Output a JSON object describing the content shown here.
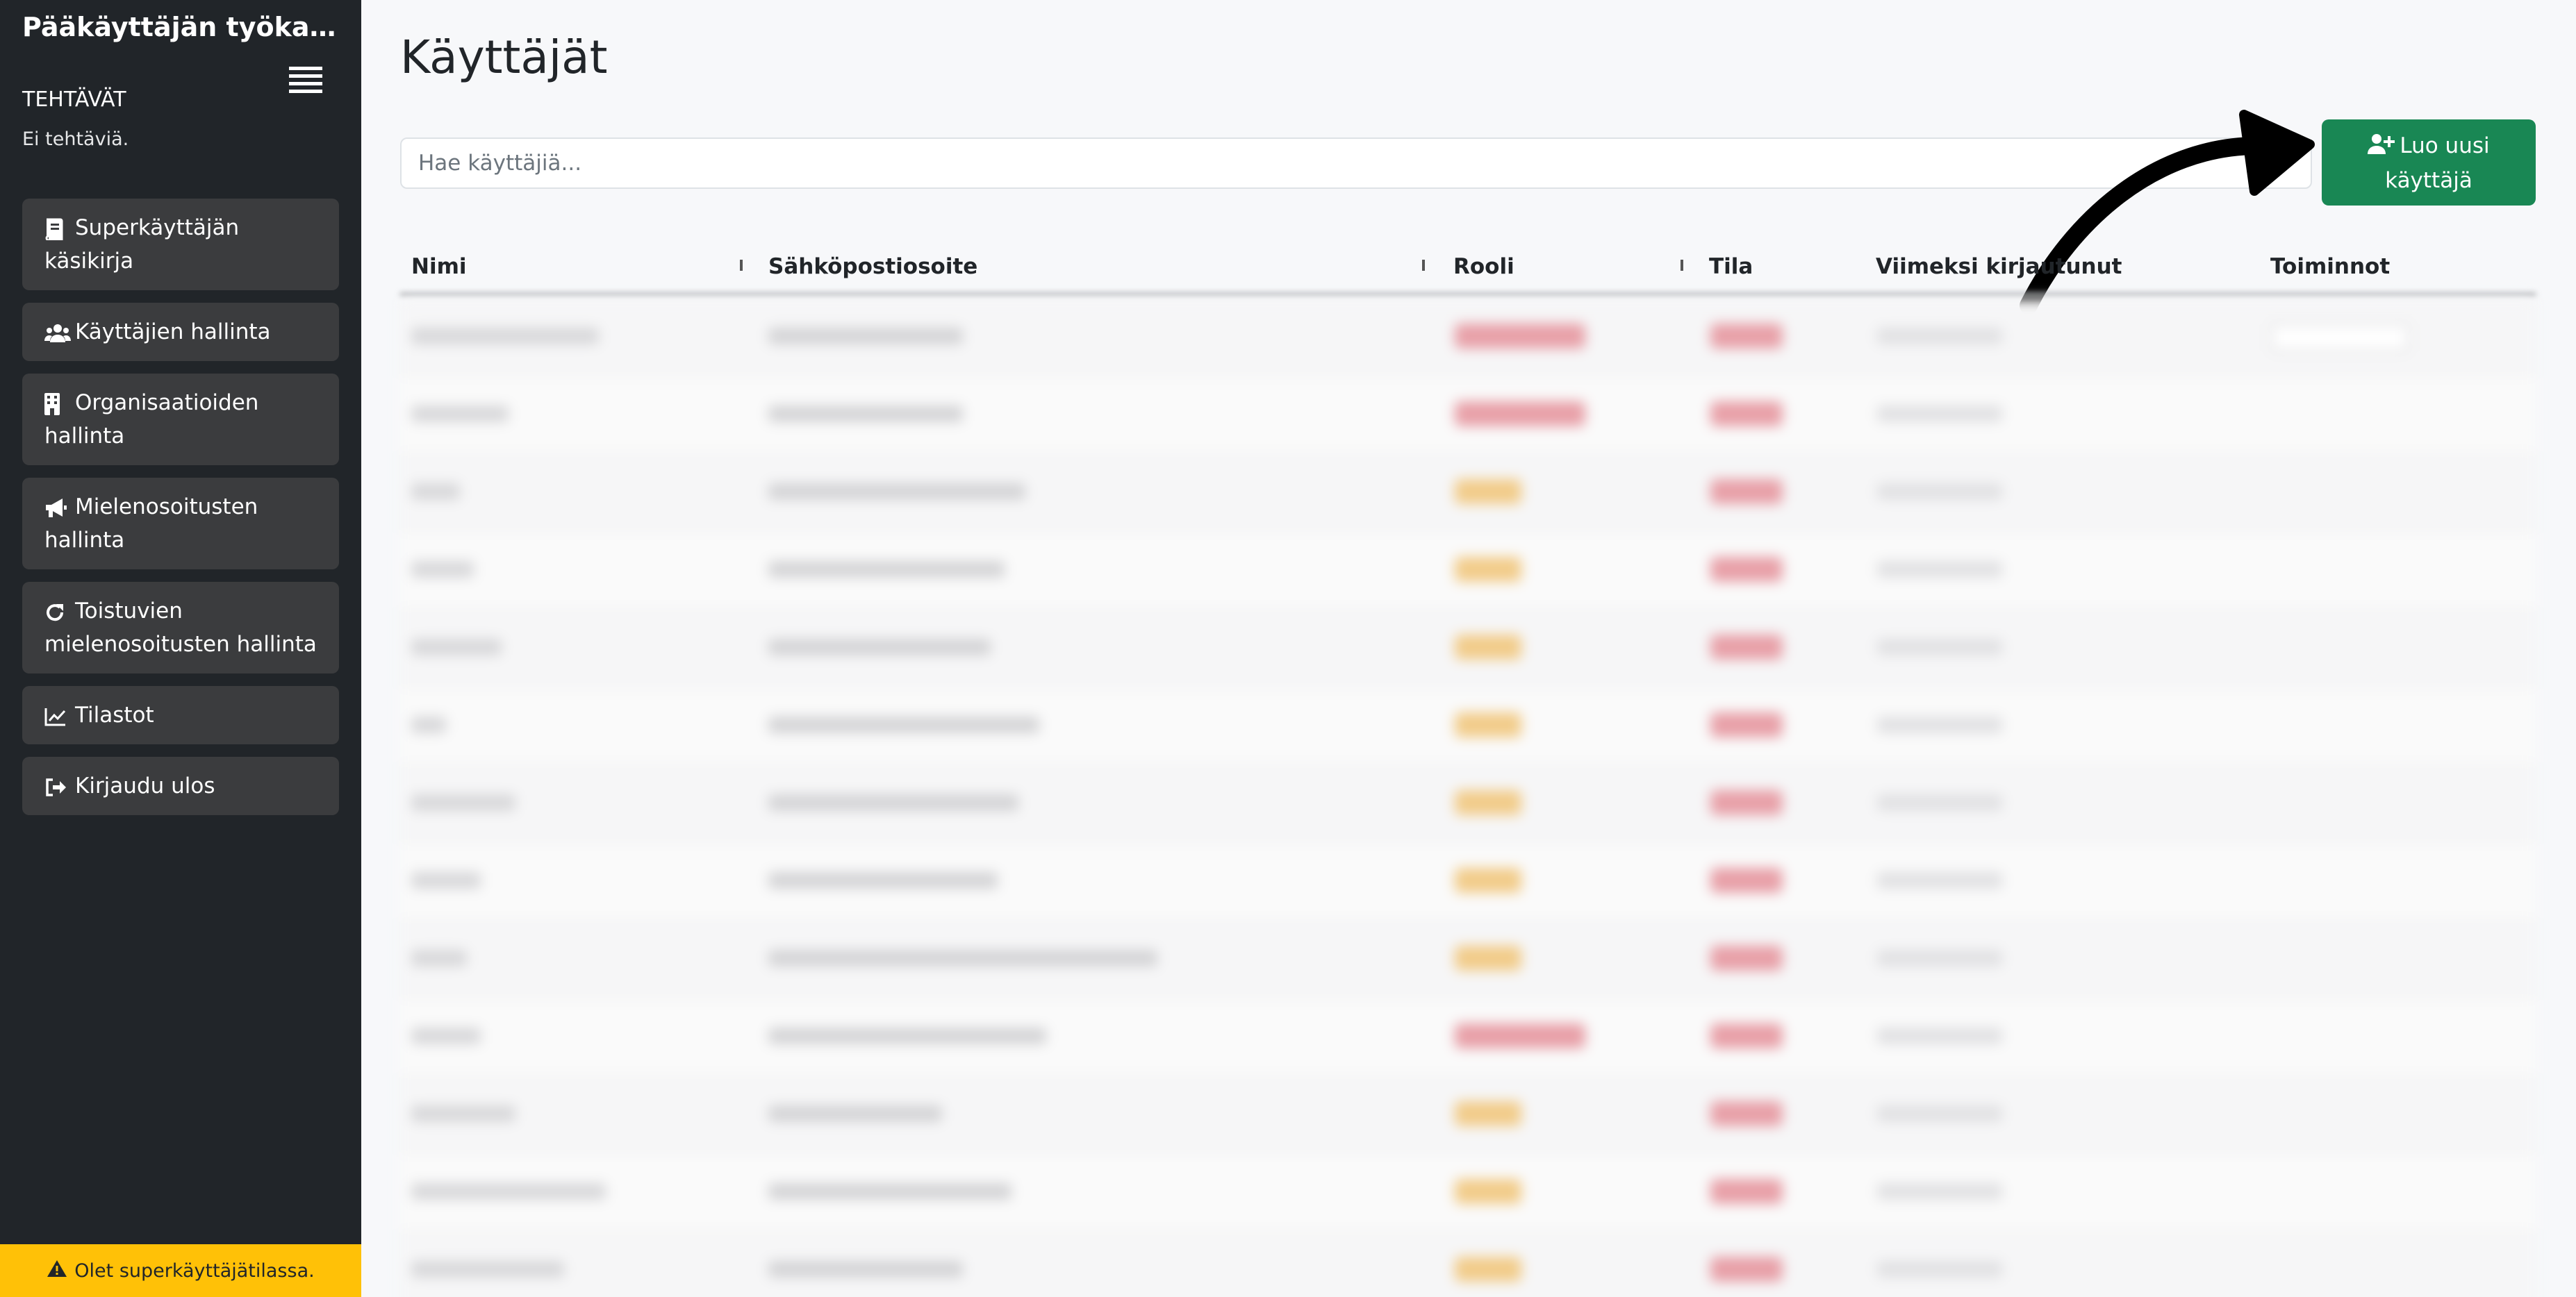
{
  "app": {
    "title": "Pääkäyttäjän työkalupaneeli"
  },
  "sidebar": {
    "tasks_heading": "TEHTÄVÄT",
    "tasks_empty": "Ei tehtäviä.",
    "items": [
      {
        "label": "Superkäyttäjän käsikirja",
        "icon": "book-icon"
      },
      {
        "label": "Käyttäjien hallinta",
        "icon": "users-icon"
      },
      {
        "label": "Organisaatioiden hallinta",
        "icon": "building-icon"
      },
      {
        "label": "Mielenosoitusten hallinta",
        "icon": "megaphone-icon"
      },
      {
        "label": "Toistuvien mielenosoitusten hallinta",
        "icon": "refresh-icon"
      },
      {
        "label": "Tilastot",
        "icon": "chart-line-icon"
      },
      {
        "label": "Kirjaudu ulos",
        "icon": "sign-out-icon"
      }
    ],
    "superuser_notice": "Olet superkäyttäjätilassa."
  },
  "main": {
    "title": "Käyttäjät",
    "search_placeholder": "Hae käyttäjiä...",
    "create_button_label": "Luo uusi käyttäjä",
    "create_button_icon": "user-plus-icon"
  },
  "table": {
    "columns": [
      "Nimi",
      "Sähköpostiosoite",
      "Rooli",
      "Tila",
      "Viimeksi kirjautunut",
      "Toiminnot"
    ],
    "rows_obscured": true
  },
  "colors": {
    "sidebar_bg": "#212529",
    "nav_item_bg": "#3b3c3e",
    "primary_green": "#198754",
    "warning_yellow": "#ffc107",
    "role_badge_admin": "#e8a0a8",
    "role_badge_user": "#f2cc8a",
    "state_badge": "#e8a0a8"
  }
}
